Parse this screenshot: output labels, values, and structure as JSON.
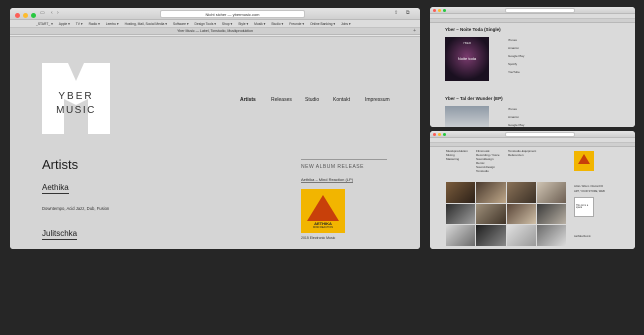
{
  "main": {
    "title_bar": "Yber Music — Label, Tonstudio, Musikproduktion",
    "url": "Nicht sicher — ybermusic.com",
    "bookmarks": [
      "_START_ ▾",
      "Apple ▾",
      "TV ▾",
      "Radio ▾",
      "Leerbu ▾",
      "Hosting, Mail, Social Media ▾",
      "Software ▾",
      "Design Tools ▾",
      "Shop ▾",
      "Style ▾",
      "Musik ▾",
      "Studio ▾",
      "Freunde ▾",
      "Online Banking ▾",
      "Jobs ▾"
    ],
    "tab": "Yber Music — Label, Tonstudio, Musikproduktion"
  },
  "logo": {
    "line1": "YBER",
    "line2": "MUSIC"
  },
  "nav": {
    "artists": "Artists",
    "releases": "Releases",
    "studio": "Studio",
    "kontakt": "Kontakt",
    "impressum": "Impressum"
  },
  "content": {
    "heading": "Artists",
    "artist1": "Aethika",
    "artist1_genre": "Downtempo, Acid Jazz, Dub, Fusion",
    "artist2": "Julitschka"
  },
  "release": {
    "heading": "NEW ALBUM RELEASE",
    "link": "Aethika – Mind Reaction (LP)",
    "cover_title": "AETHIKA",
    "cover_sub": "MIND REACTION",
    "caption": "2015 Electronic Music"
  },
  "win2": {
    "title1": "Yber – Noite Toda (Single)",
    "cover_top": "YBER",
    "cover_text": "Noite toda",
    "links": [
      "iTunes",
      "Amazon",
      "Google Play",
      "Spotify",
      "YouTube"
    ],
    "title2": "Yber – Tal der Wunder (EP)",
    "links2": [
      "iTunes",
      "Amazon",
      "Google Play"
    ]
  },
  "win3": {
    "col1": [
      "Musikproduktion",
      "Mixing",
      "Mastering"
    ],
    "col2": [
      "Filmmusik",
      "Recording / Voice",
      "Sounddesign",
      "Remix",
      "Sound-Design",
      "Tonstudio"
    ],
    "col3": [
      "Tonstudio-Equipment",
      "Referenzen"
    ],
    "side_text": "Artist / Album / Record ID",
    "side_text2": "ART, YOUR STORE, WEB",
    "side_caption": "This pic is a space",
    "side_link": "Aethika Remix"
  }
}
